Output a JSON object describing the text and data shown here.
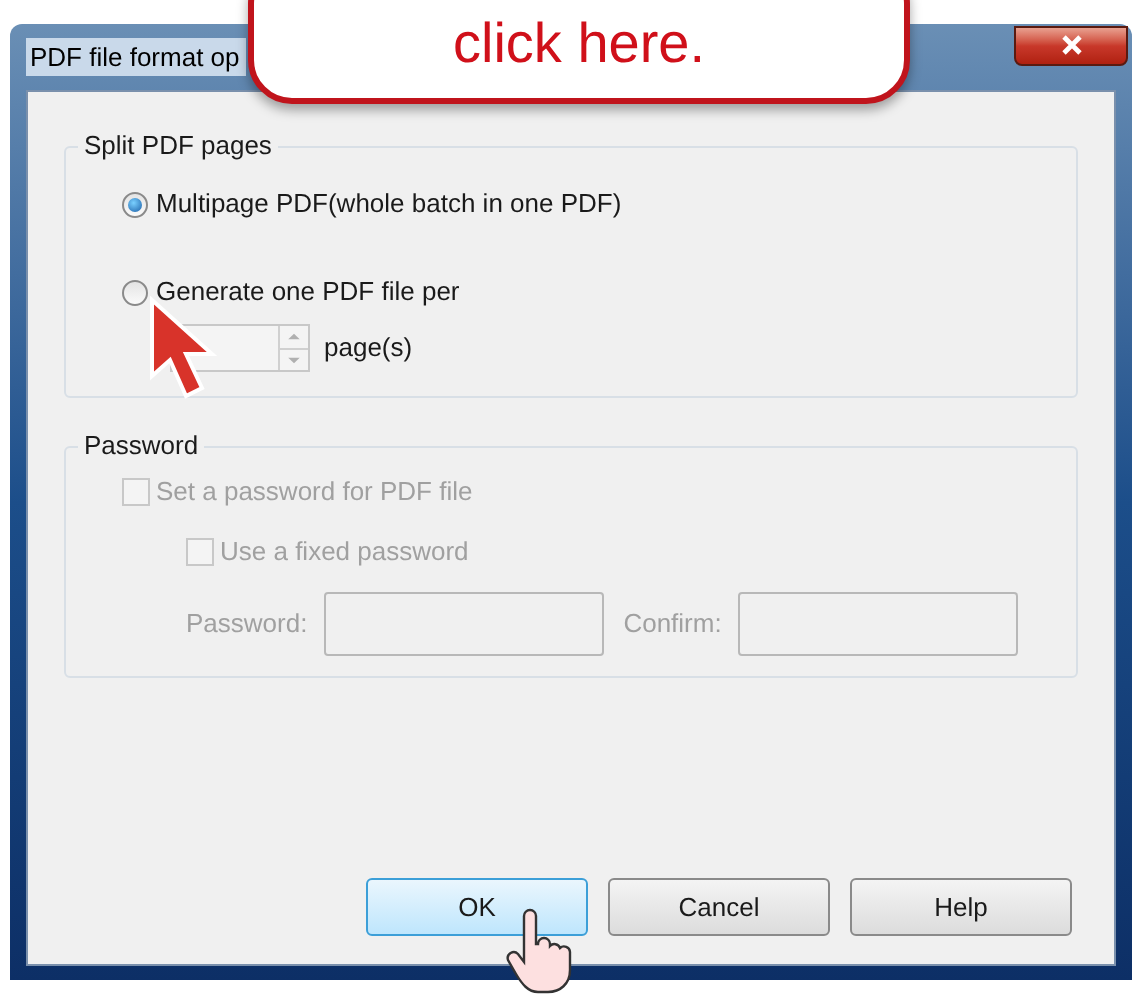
{
  "window": {
    "title": "PDF file format op"
  },
  "callout": {
    "text": "click here."
  },
  "split_group": {
    "title": "Split PDF pages",
    "options": [
      {
        "label": "Multipage PDF(whole batch in one PDF)",
        "selected": true
      },
      {
        "label": "Generate one PDF file per",
        "selected": false
      }
    ],
    "pages_unit": "page(s)"
  },
  "password_group": {
    "title": "Password",
    "disabled": true,
    "set_password": {
      "label": "Set a password for PDF file",
      "checked": false
    },
    "fixed_password": {
      "label": "Use a fixed password",
      "checked": false
    },
    "fields": [
      {
        "label": "Password:"
      },
      {
        "label": "Confirm:"
      }
    ]
  },
  "buttons": [
    {
      "label": "OK",
      "default": true
    },
    {
      "label": "Cancel",
      "default": false
    },
    {
      "label": "Help",
      "default": false
    }
  ]
}
